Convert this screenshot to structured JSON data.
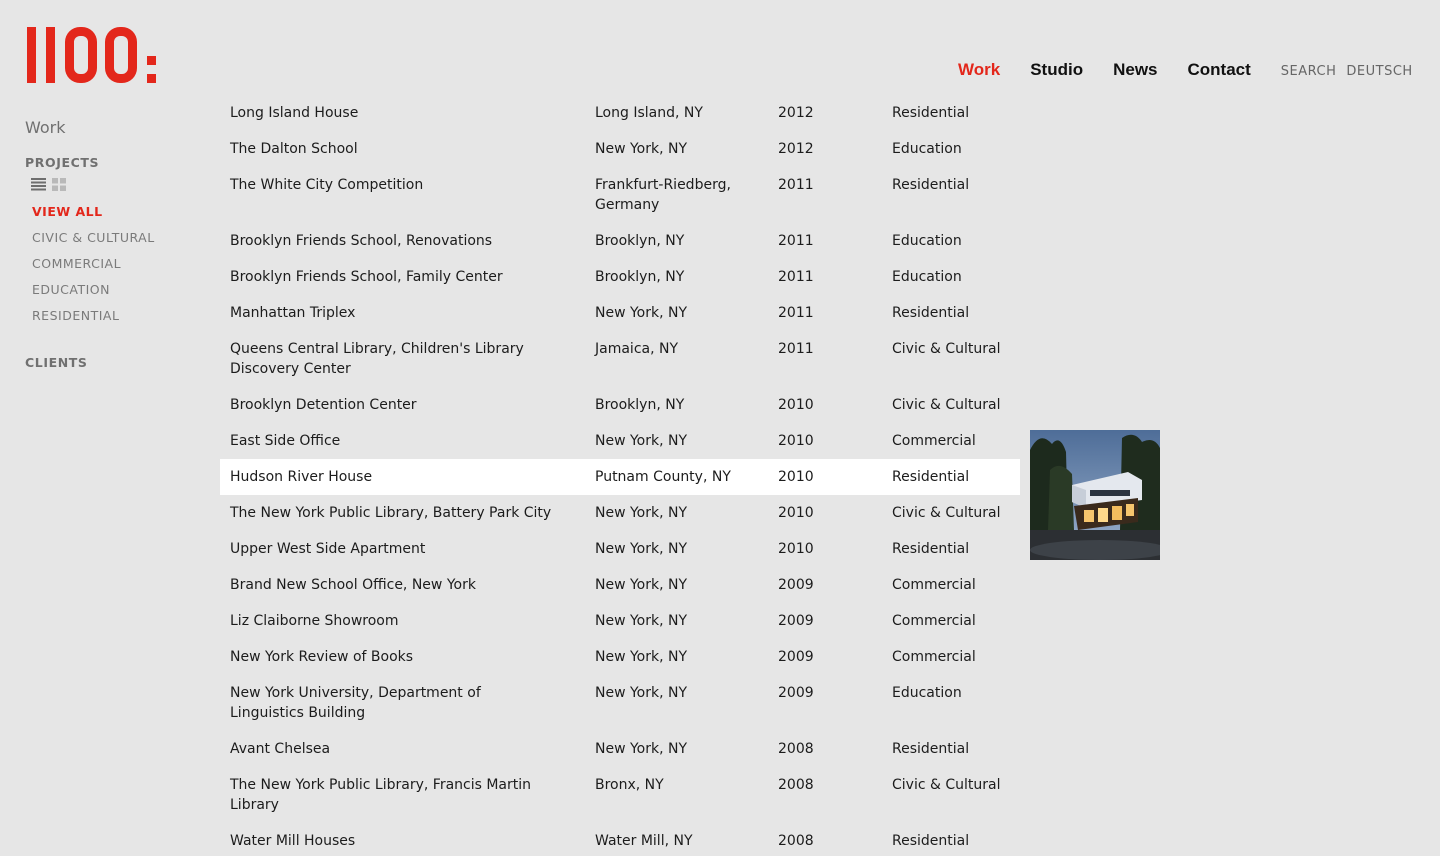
{
  "brand": {
    "logo_text": "1100:",
    "accent": "#e3271b"
  },
  "nav": {
    "links": [
      {
        "label": "Work",
        "active": true
      },
      {
        "label": "Studio",
        "active": false
      },
      {
        "label": "News",
        "active": false
      },
      {
        "label": "Contact",
        "active": false
      }
    ],
    "search_label": "SEARCH",
    "language_label": "DEUTSCH"
  },
  "sidebar": {
    "title": "Work",
    "projects_label": "PROJECTS",
    "view_icons": [
      "list-view-icon",
      "grid-view-icon"
    ],
    "filters": [
      "VIEW ALL",
      "CIVIC & CULTURAL",
      "COMMERCIAL",
      "EDUCATION",
      "RESIDENTIAL"
    ],
    "active_filter": "VIEW ALL",
    "clients_label": "CLIENTS"
  },
  "projects": [
    {
      "name": "Long Island House",
      "location": "Long Island, NY",
      "year": "2012",
      "type": "Residential"
    },
    {
      "name": "The Dalton School",
      "location": "New York, NY",
      "year": "2012",
      "type": "Education"
    },
    {
      "name": "The White City Competition",
      "location": "Frankfurt-Riedberg, Germany",
      "year": "2011",
      "type": "Residential"
    },
    {
      "name": "Brooklyn Friends School, Renovations",
      "location": "Brooklyn, NY",
      "year": "2011",
      "type": "Education"
    },
    {
      "name": "Brooklyn Friends School, Family Center",
      "location": "Brooklyn, NY",
      "year": "2011",
      "type": "Education"
    },
    {
      "name": "Manhattan Triplex",
      "location": "New York, NY",
      "year": "2011",
      "type": "Residential"
    },
    {
      "name": "Queens Central Library, Children's Library Discovery Center",
      "location": "Jamaica, NY",
      "year": "2011",
      "type": "Civic & Cultural"
    },
    {
      "name": "Brooklyn Detention Center",
      "location": "Brooklyn, NY",
      "year": "2010",
      "type": "Civic & Cultural"
    },
    {
      "name": "East Side Office",
      "location": "New York, NY",
      "year": "2010",
      "type": "Commercial"
    },
    {
      "name": "Hudson River House",
      "location": "Putnam County, NY",
      "year": "2010",
      "type": "Residential",
      "highlight": true
    },
    {
      "name": "The New York Public Library, Battery Park City",
      "location": "New York, NY",
      "year": "2010",
      "type": "Civic & Cultural"
    },
    {
      "name": "Upper West Side Apartment",
      "location": "New York, NY",
      "year": "2010",
      "type": "Residential"
    },
    {
      "name": "Brand New School Office, New York",
      "location": "New York, NY",
      "year": "2009",
      "type": "Commercial"
    },
    {
      "name": "Liz Claiborne Showroom",
      "location": "New York, NY",
      "year": "2009",
      "type": "Commercial"
    },
    {
      "name": "New York Review of Books",
      "location": "New York, NY",
      "year": "2009",
      "type": "Commercial"
    },
    {
      "name": "New York University, Department of Linguistics Building",
      "location": "New York, NY",
      "year": "2009",
      "type": "Education"
    },
    {
      "name": "Avant Chelsea",
      "location": "New York, NY",
      "year": "2008",
      "type": "Residential"
    },
    {
      "name": "The New York Public Library, Francis Martin Library",
      "location": "Bronx, NY",
      "year": "2008",
      "type": "Civic & Cultural"
    },
    {
      "name": "Water Mill Houses",
      "location": "Water Mill, NY",
      "year": "2008",
      "type": "Residential"
    }
  ],
  "preview": {
    "for_project": "Hudson River House",
    "icon": "house-photo"
  }
}
